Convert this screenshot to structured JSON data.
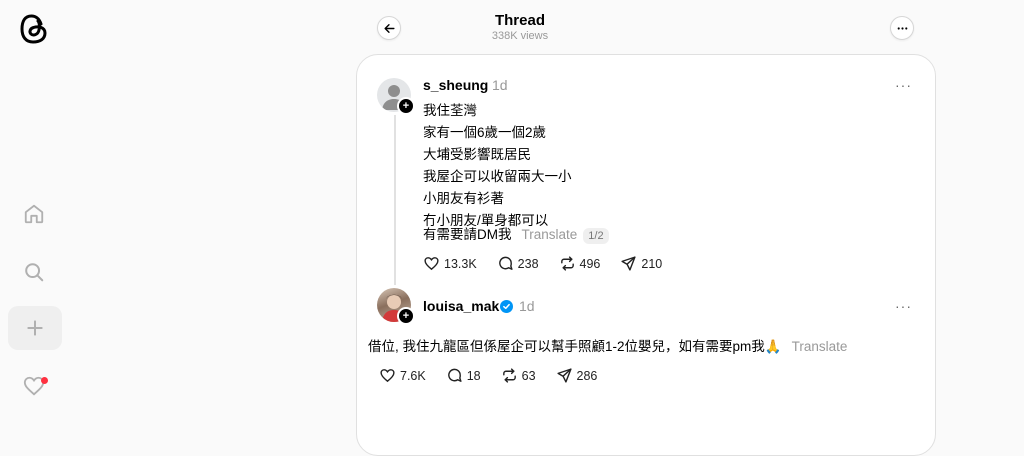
{
  "header": {
    "title": "Thread",
    "subtitle": "338K views"
  },
  "nav": {
    "icons": [
      "threads-logo-icon",
      "home-icon",
      "search-icon",
      "plus-icon",
      "heart-icon"
    ]
  },
  "post1": {
    "username": "s_sheung",
    "time": "1d",
    "lines": [
      "我住荃灣",
      "家有一個6歲一個2歲",
      "大埔受影響既居民",
      "我屋企可以收留兩大一小",
      "小朋友有衫著",
      "冇小朋友/單身都可以"
    ],
    "last_line": "有需要請DM我",
    "translate": "Translate",
    "pager": "1/2",
    "likes": "13.3K",
    "comments": "238",
    "reposts": "496",
    "shares": "210"
  },
  "post2": {
    "username": "louisa_mak",
    "time": "1d",
    "text": "借位, 我住九龍區但係屋企可以幫手照顧1-2位嬰兒，如有需要pm我🙏",
    "translate": "Translate",
    "likes": "7.6K",
    "comments": "18",
    "reposts": "63",
    "shares": "286"
  },
  "colors": {
    "accent": "#0095f6",
    "notification": "#ff3040"
  }
}
